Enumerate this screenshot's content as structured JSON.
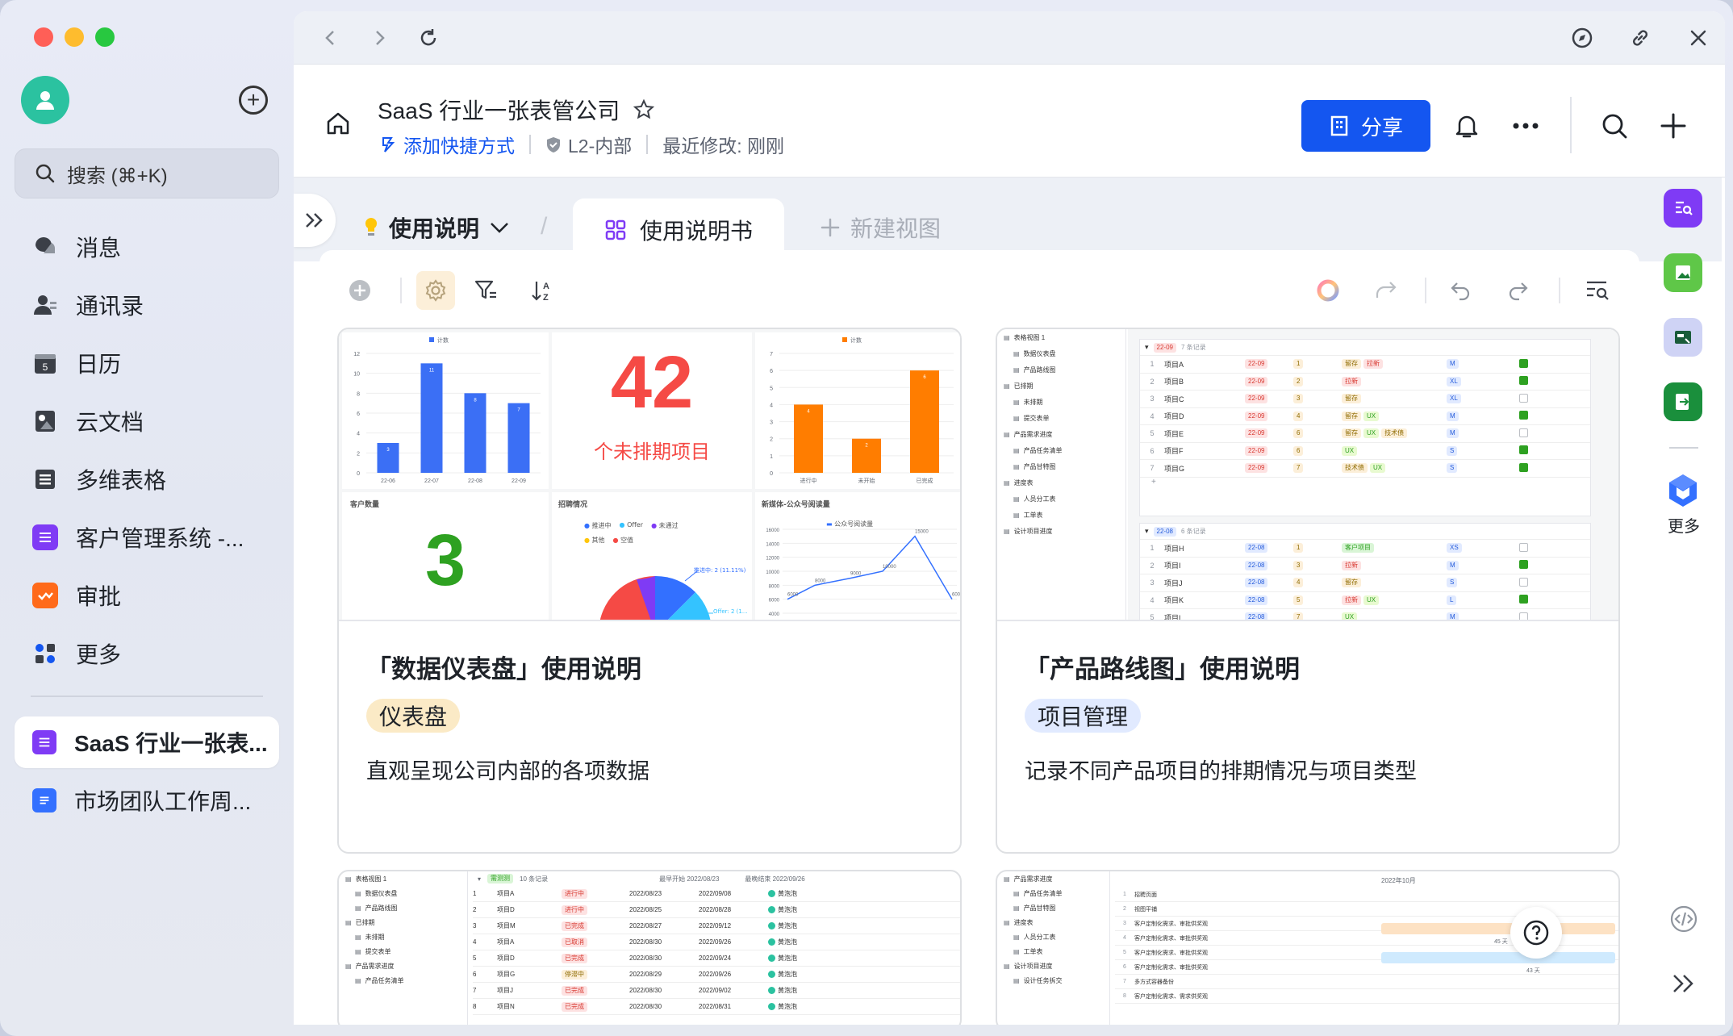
{
  "sidebar": {
    "search_placeholder": "搜索 (⌘+K)",
    "items": [
      {
        "label": "消息",
        "icon": "message-icon"
      },
      {
        "label": "通讯录",
        "icon": "contacts-icon"
      },
      {
        "label": "日历",
        "icon": "calendar-icon"
      },
      {
        "label": "云文档",
        "icon": "docs-icon"
      },
      {
        "label": "多维表格",
        "icon": "base-icon"
      },
      {
        "label": "客户管理系统 -...",
        "icon": "crm-icon"
      },
      {
        "label": "审批",
        "icon": "approval-icon"
      },
      {
        "label": "更多",
        "icon": "more-apps-icon"
      }
    ],
    "pinned": [
      {
        "label": "SaaS 行业一张表..."
      },
      {
        "label": "市场团队工作周..."
      }
    ]
  },
  "header": {
    "title": "SaaS 行业一张表管公司",
    "shortcut": "添加快捷方式",
    "security": "L2-内部",
    "modified": "最近修改: 刚刚",
    "share_label": "分享"
  },
  "tabs": {
    "view_selector": "使用说明",
    "active": "使用说明书",
    "new_view": "新建视图"
  },
  "cards": [
    {
      "title": "「数据仪表盘」使用说明",
      "tag": "仪表盘",
      "desc": "直观呈现公司内部的各项数据"
    },
    {
      "title": "「产品路线图」使用说明",
      "tag": "项目管理",
      "desc": "记录不同产品项目的排期情况与项目类型"
    }
  ],
  "dashboard_thumb": {
    "bar1": {
      "legend": "计数",
      "categories": [
        "22-06",
        "22-07",
        "22-08",
        "22-09"
      ],
      "values": [
        3,
        11,
        8,
        7
      ],
      "ymax": 12,
      "yticks": [
        "12",
        "10",
        "8",
        "6",
        "4",
        "2",
        "0"
      ]
    },
    "big_number": "42",
    "big_label": "个未排期项目",
    "bar2": {
      "legend": "计数",
      "categories": [
        "进行中",
        "未开始",
        "已完成"
      ],
      "values": [
        4,
        2,
        6
      ],
      "ymax": 7,
      "yticks": [
        "7",
        "6",
        "5",
        "4",
        "3",
        "2",
        "1",
        "0"
      ]
    },
    "customers_title": "客户数量",
    "customers_value": "3",
    "hiring_title": "招聘情况",
    "hiring_legend": [
      "推进中",
      "Offer",
      "未通过",
      "其他",
      "空值"
    ],
    "hiring_label1": "推进中: 2 (11.11%)",
    "hiring_label2": "Offer: 2 (1...",
    "media_title": "新媒体-公众号阅读量",
    "media_legend": "公众号阅读量",
    "media_yticks": [
      "16000",
      "14000",
      "12000",
      "10000",
      "8000",
      "6000",
      "4000"
    ],
    "media_points": [
      "6000",
      "8000",
      "9000",
      "10000",
      "15000",
      "6000"
    ]
  },
  "roadmap_thumb": {
    "tree": [
      "表格视图 1",
      "数据仪表盘",
      "产品路线图",
      "已排期",
      "未排期",
      "提交表单",
      "产品需求进度",
      "产品任务清单",
      "产品甘特图",
      "进度表",
      "人员分工表",
      "工单表",
      "设计项目进度"
    ],
    "group1": "22-09",
    "group1_count": "7 条记录",
    "group1_rows": [
      {
        "n": "1",
        "name": "项目A",
        "date": "22-09",
        "p": "1",
        "tags": [
          "留存",
          "拉新"
        ],
        "size": "M",
        "check": true
      },
      {
        "n": "2",
        "name": "项目B",
        "date": "22-09",
        "p": "2",
        "tags": [
          "拉新"
        ],
        "size": "XL",
        "check": true
      },
      {
        "n": "3",
        "name": "项目C",
        "date": "22-09",
        "p": "3",
        "tags": [
          "留存"
        ],
        "size": "XL",
        "check": false
      },
      {
        "n": "4",
        "name": "项目D",
        "date": "22-09",
        "p": "4",
        "tags": [
          "留存",
          "UX"
        ],
        "size": "M",
        "check": true
      },
      {
        "n": "5",
        "name": "项目E",
        "date": "22-09",
        "p": "6",
        "tags": [
          "留存",
          "UX",
          "技术债"
        ],
        "size": "M",
        "check": false
      },
      {
        "n": "6",
        "name": "项目F",
        "date": "22-09",
        "p": "6",
        "tags": [
          "UX"
        ],
        "size": "S",
        "check": true
      },
      {
        "n": "7",
        "name": "项目G",
        "date": "22-09",
        "p": "7",
        "tags": [
          "技术债",
          "UX"
        ],
        "size": "S",
        "check": true
      }
    ],
    "group2": "22-08",
    "group2_count": "6 条记录",
    "group2_rows": [
      {
        "n": "1",
        "name": "项目H",
        "date": "22-08",
        "p": "1",
        "tags": [
          "客户项目"
        ],
        "size": "XS",
        "check": false
      },
      {
        "n": "2",
        "name": "项目I",
        "date": "22-08",
        "p": "3",
        "tags": [
          "拉新"
        ],
        "size": "M",
        "check": true
      },
      {
        "n": "3",
        "name": "项目J",
        "date": "22-08",
        "p": "4",
        "tags": [
          "留存"
        ],
        "size": "S",
        "check": false
      },
      {
        "n": "4",
        "name": "项目K",
        "date": "22-08",
        "p": "5",
        "tags": [
          "拉新",
          "UX"
        ],
        "size": "L",
        "check": true
      },
      {
        "n": "5",
        "name": "项目L",
        "date": "22-08",
        "p": "7",
        "tags": [
          "UX"
        ],
        "size": "M",
        "check": false
      }
    ]
  },
  "bottom_thumb1": {
    "tree": [
      "表格视图 1",
      "数据仪表盘",
      "产品路线图",
      "已排期",
      "未排期",
      "提交表单",
      "产品需求进度",
      "产品任务清单"
    ],
    "group": "需测测",
    "group_count": "10 条记录",
    "col1": "最早开始 2022/08/23",
    "col2": "最晚结束 2022/09/26",
    "rows": [
      {
        "n": "1",
        "name": "项目A",
        "status": "进行中",
        "start": "2022/08/23",
        "end": "2022/09/08",
        "owner": "黄泡泡"
      },
      {
        "n": "2",
        "name": "项目D",
        "status": "进行中",
        "start": "2022/08/25",
        "end": "2022/08/28",
        "owner": "黄泡泡"
      },
      {
        "n": "3",
        "name": "项目M",
        "status": "已完成",
        "start": "2022/08/27",
        "end": "2022/09/12",
        "owner": "黄泡泡"
      },
      {
        "n": "4",
        "name": "项目A",
        "status": "已取消",
        "start": "2022/08/30",
        "end": "2022/09/26",
        "owner": "黄泡泡"
      },
      {
        "n": "5",
        "name": "项目D",
        "status": "已完成",
        "start": "2022/08/30",
        "end": "2022/09/24",
        "owner": "黄泡泡"
      },
      {
        "n": "6",
        "name": "项目G",
        "status": "停滞中",
        "start": "2022/08/29",
        "end": "2022/09/26",
        "owner": "黄泡泡"
      },
      {
        "n": "7",
        "name": "项目J",
        "status": "已完成",
        "start": "2022/08/30",
        "end": "2022/09/02",
        "owner": "黄泡泡"
      },
      {
        "n": "8",
        "name": "项目N",
        "status": "已完成",
        "start": "2022/08/30",
        "end": "2022/08/31",
        "owner": "黄泡泡"
      }
    ]
  },
  "bottom_thumb2": {
    "tree": [
      "产品需求进度",
      "产品任务清单",
      "产品甘特图",
      "进度表",
      "人员分工表",
      "工单表",
      "设计项目进度",
      "设计任务拆交"
    ],
    "month": "2022年10月",
    "tasks": [
      "招聘页面",
      "视图平铺",
      "客户定制化需求、审批供奖观",
      "客户定制化需求、审批供奖观",
      "客户定制化需求、审批供奖观",
      "客户定制化需求、审批供奖观",
      "多方式容器备份",
      "客户定制化需求、需求供奖观"
    ],
    "bar1": "45 天",
    "bar2": "43 天"
  },
  "right_sidebar": {
    "more_label": "更多"
  },
  "colors": {
    "accent": "#1456f0",
    "bar_blue": "#3b6ff5",
    "bar_orange": "#ff7d00",
    "red": "#f54a45",
    "green": "#2ea121"
  }
}
